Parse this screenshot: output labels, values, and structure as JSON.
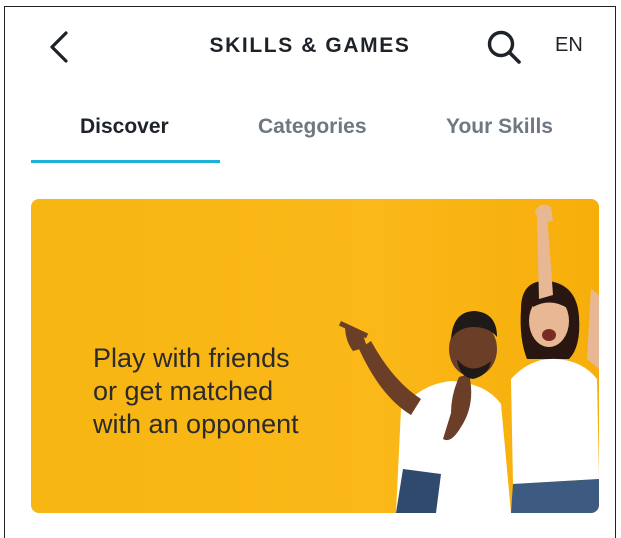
{
  "header": {
    "title": "SKILLS & GAMES",
    "language": "EN",
    "back_icon": "chevron-left-icon",
    "search_icon": "search-icon"
  },
  "tabs": [
    {
      "label": "Discover",
      "active": true
    },
    {
      "label": "Categories",
      "active": false
    },
    {
      "label": "Your Skills",
      "active": false
    }
  ],
  "banner": {
    "lines": [
      "Play with friends",
      "or get matched",
      "with an opponent"
    ],
    "background_color": "#fbb819"
  },
  "colors": {
    "accent": "#1ab2d6",
    "text_primary": "#1e2329",
    "text_secondary": "#6f7780"
  }
}
